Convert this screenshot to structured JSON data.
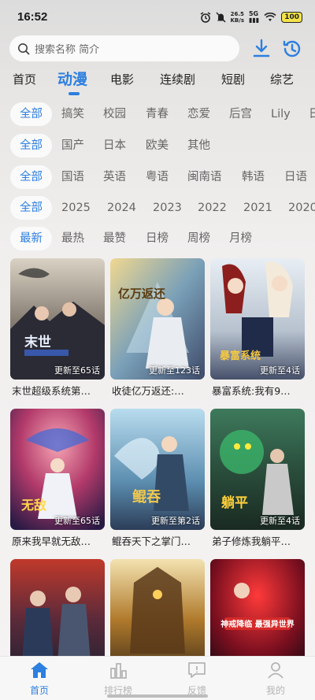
{
  "status": {
    "time": "16:52",
    "speed": "26.5",
    "speed_unit": "KB/s",
    "signal": "5G",
    "battery": "100"
  },
  "search": {
    "placeholder": "搜索名称 简介"
  },
  "icons": {
    "download": "download-icon",
    "history": "history-icon",
    "search": "search-icon"
  },
  "colors": {
    "accent": "#2d7fe0",
    "chip_bg": "#fafafa",
    "text_muted": "#666666"
  },
  "main_tabs": [
    "首页",
    "动漫",
    "电影",
    "连续剧",
    "短剧",
    "综艺"
  ],
  "filters": {
    "genre": [
      "全部",
      "搞笑",
      "校园",
      "青春",
      "恋爱",
      "后宫",
      "Lily",
      "日"
    ],
    "region": [
      "全部",
      "国产",
      "日本",
      "欧美",
      "其他"
    ],
    "language": [
      "全部",
      "国语",
      "英语",
      "粤语",
      "闽南语",
      "韩语",
      "日语"
    ],
    "year": [
      "全部",
      "2025",
      "2024",
      "2023",
      "2022",
      "2021",
      "2020"
    ],
    "sort": [
      "最新",
      "最热",
      "最赞",
      "日榜",
      "周榜",
      "月榜"
    ]
  },
  "cards": [
    {
      "title": "末世超级系统第…",
      "badge": "更新至65话",
      "art": "末世"
    },
    {
      "title": "收徒亿万返还:…",
      "badge": "更新至123话",
      "art": "亿万返还"
    },
    {
      "title": "暴富系统:我有9…",
      "badge": "更新至4话",
      "art": "暴富系统"
    },
    {
      "title": "原来我早就无敌…",
      "badge": "更新至65话",
      "art": "无敌"
    },
    {
      "title": "鲲吞天下之掌门…",
      "badge": "更新至第2话",
      "art": "鲲吞"
    },
    {
      "title": "弟子修炼我躺平…",
      "badge": "更新至4话",
      "art": "躺平"
    },
    {
      "title": "",
      "badge": "",
      "art": ""
    },
    {
      "title": "",
      "badge": "",
      "art": ""
    },
    {
      "title": "",
      "badge": "",
      "art": "神戒降临 最强异世界"
    }
  ],
  "bottom_nav": [
    "首页",
    "排行榜",
    "反馈",
    "我的"
  ]
}
